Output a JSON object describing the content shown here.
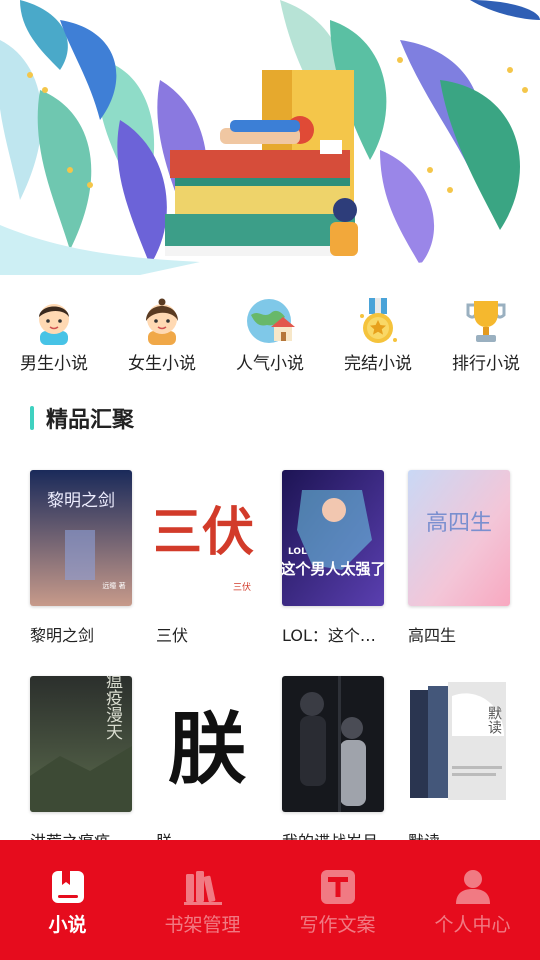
{
  "categories": [
    {
      "label": "男生小说",
      "icon": "boy-avatar-icon"
    },
    {
      "label": "女生小说",
      "icon": "girl-avatar-icon"
    },
    {
      "label": "人气小说",
      "icon": "globe-house-icon"
    },
    {
      "label": "完结小说",
      "icon": "medal-star-icon"
    },
    {
      "label": "排行小说",
      "icon": "trophy-icon"
    }
  ],
  "section": {
    "title": "精品汇聚"
  },
  "books": [
    {
      "title": "黎明之剑",
      "cover_text": "黎明之剑",
      "cover_sub": "远瞳 著"
    },
    {
      "title": "三伏",
      "cover_text": "三伏",
      "cover_sub": "三伏"
    },
    {
      "title": "LOL：这个男人太强了",
      "cover_text": "这个男人太强了",
      "cover_sub": "LOL"
    },
    {
      "title": "高四生",
      "cover_text": "高四生",
      "cover_sub": ""
    },
    {
      "title": "洪荒之瘟疫",
      "cover_text": "瘟疫漫天",
      "cover_sub": ""
    },
    {
      "title": "朕",
      "cover_text": "朕",
      "cover_sub": ""
    },
    {
      "title": "我的谍战岁月",
      "cover_text": "",
      "cover_sub": ""
    },
    {
      "title": "默读",
      "cover_text": "默读",
      "cover_sub": ""
    }
  ],
  "tabs": [
    {
      "label": "小说",
      "icon": "book-bookmark-icon",
      "active": true
    },
    {
      "label": "书架管理",
      "icon": "bookshelf-icon",
      "active": false
    },
    {
      "label": "写作文案",
      "icon": "text-t-icon",
      "active": false
    },
    {
      "label": "个人中心",
      "icon": "person-icon",
      "active": false
    }
  ],
  "colors": {
    "tabbar": "#e60c1d",
    "accent": "#3fd1c0"
  }
}
